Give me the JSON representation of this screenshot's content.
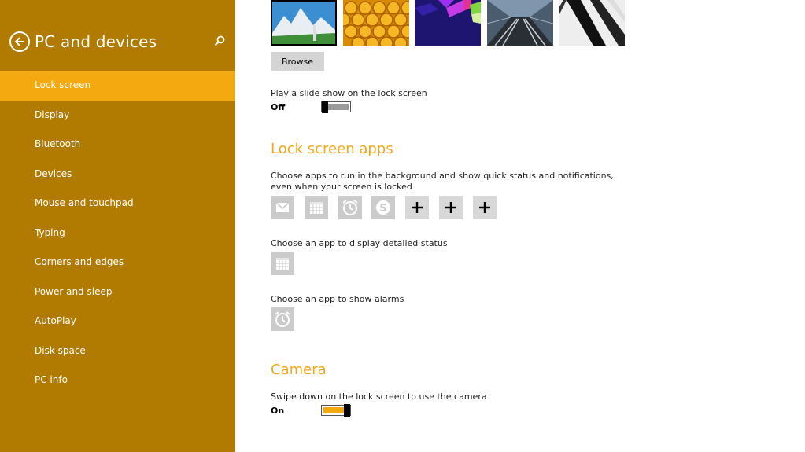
{
  "sidebar": {
    "title": "PC and devices",
    "items": [
      {
        "label": "Lock screen",
        "active": true
      },
      {
        "label": "Display"
      },
      {
        "label": "Bluetooth"
      },
      {
        "label": "Devices"
      },
      {
        "label": "Mouse and touchpad"
      },
      {
        "label": "Typing"
      },
      {
        "label": "Corners and edges"
      },
      {
        "label": "Power and sleep"
      },
      {
        "label": "AutoPlay"
      },
      {
        "label": "Disk space"
      },
      {
        "label": "PC info"
      }
    ]
  },
  "lock_screen": {
    "thumbnails": [
      "mountain-lake-image",
      "honeycomb-image",
      "geometric-cubes-image",
      "railway-tunnel-image",
      "piano-keys-image"
    ],
    "browse_label": "Browse",
    "slideshow_label": "Play a slide show on the lock screen",
    "slideshow_state": "Off"
  },
  "lock_screen_apps": {
    "title": "Lock screen apps",
    "description": "Choose apps to run in the background and show quick status and notifications, even when your screen is locked",
    "apps": [
      "mail-icon",
      "calendar-icon",
      "alarm-icon",
      "skype-icon",
      "plus-icon",
      "plus-icon",
      "plus-icon"
    ],
    "detailed_label": "Choose an app to display detailed status",
    "alarms_label": "Choose an app to show alarms"
  },
  "camera": {
    "title": "Camera",
    "label": "Swipe down on the lock screen to use the camera",
    "state": "On"
  },
  "colors": {
    "sidebar_bg": "#b07b00",
    "accent": "#f3a90f",
    "section_title": "#f0a91a"
  }
}
